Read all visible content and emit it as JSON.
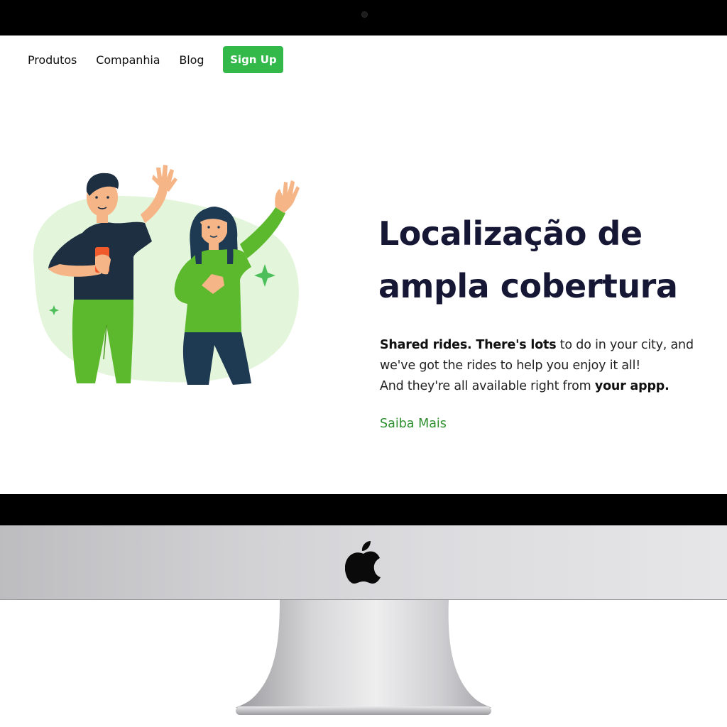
{
  "nav": {
    "links": [
      {
        "label": "Produtos"
      },
      {
        "label": "Companhia"
      },
      {
        "label": "Blog"
      }
    ],
    "signup_label": "Sign Up"
  },
  "hero": {
    "title_line1": "Localização de",
    "title_line2": "ampla cobertura",
    "desc": {
      "l1_bold": "Shared rides. There's lots",
      "l1_rest": " to do in your city, and",
      "l2": "we've got the rides to help you enjoy it all!",
      "l3_rest": "And they're all available right from ",
      "l3_bold": "your appp."
    },
    "link_label": "Saiba Mais"
  },
  "colors": {
    "accent": "#33b84a",
    "title": "#161735",
    "link": "#2d8f2d",
    "illustration_bg": "#e3f5da",
    "shirt_green": "#5cb82c",
    "navy": "#1d3a52"
  },
  "icons": [
    "apple-logo-icon",
    "sparkle-icon"
  ]
}
